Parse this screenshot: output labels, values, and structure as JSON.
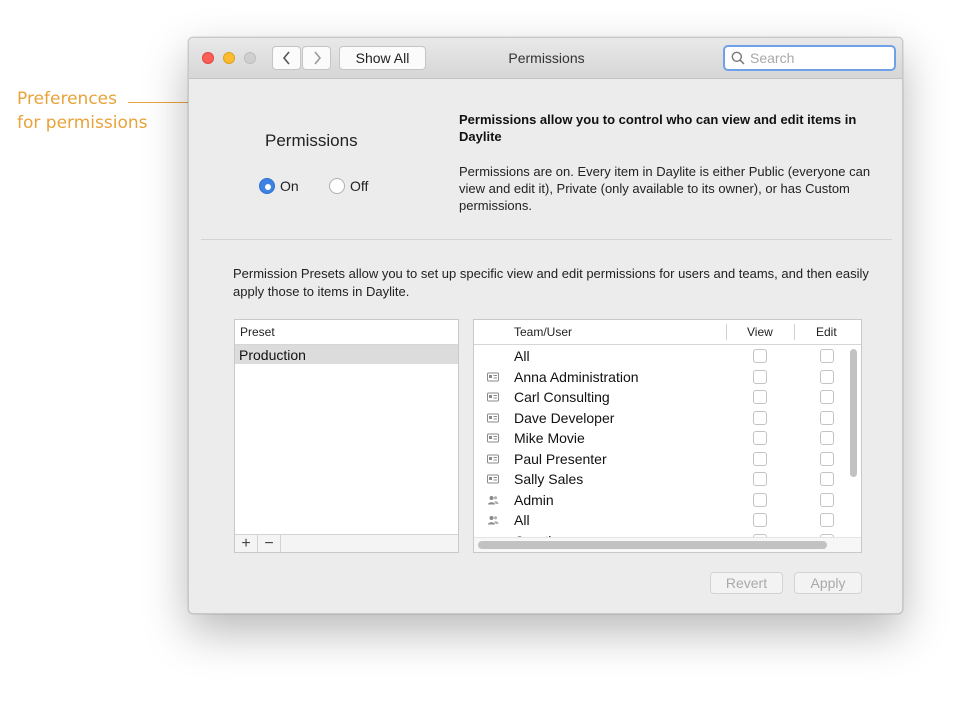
{
  "callout": {
    "line1": "Preferences",
    "line2": "for permissions"
  },
  "window": {
    "title": "Permissions",
    "show_all_label": "Show All",
    "search_placeholder": "Search"
  },
  "permissions": {
    "heading": "Permissions",
    "on_label": "On",
    "off_label": "Off",
    "selected": "On",
    "desc_title": "Permissions allow you to control who can view and edit items in Daylite",
    "desc_body": "Permissions are on. Every item in Daylite is either Public (everyone can view and edit it), Private (only available to its owner), or has Custom permissions."
  },
  "presets": {
    "description": "Permission Presets allow you to set up specific view and edit permissions for users and teams, and then easily apply those to items in Daylite.",
    "header": "Preset",
    "items": [
      "Production"
    ],
    "add_label": "+",
    "remove_label": "−"
  },
  "team_table": {
    "col_team": "Team/User",
    "col_view": "View",
    "col_edit": "Edit",
    "rows": [
      {
        "name": "All",
        "icon": "none"
      },
      {
        "name": "Anna Administration",
        "icon": "user-card-icon"
      },
      {
        "name": "Carl Consulting",
        "icon": "user-card-icon"
      },
      {
        "name": "Dave Developer",
        "icon": "user-card-icon"
      },
      {
        "name": "Mike Movie",
        "icon": "user-card-icon"
      },
      {
        "name": "Paul Presenter",
        "icon": "user-card-icon"
      },
      {
        "name": "Sally Sales",
        "icon": "user-card-icon"
      },
      {
        "name": "Admin",
        "icon": "team-icon"
      },
      {
        "name": "All",
        "icon": "team-icon"
      },
      {
        "name": "Creative",
        "icon": "team-icon"
      }
    ]
  },
  "footer": {
    "revert_label": "Revert",
    "apply_label": "Apply"
  },
  "colors": {
    "accent": "#3e83e4",
    "callout": "#e8a33a"
  }
}
